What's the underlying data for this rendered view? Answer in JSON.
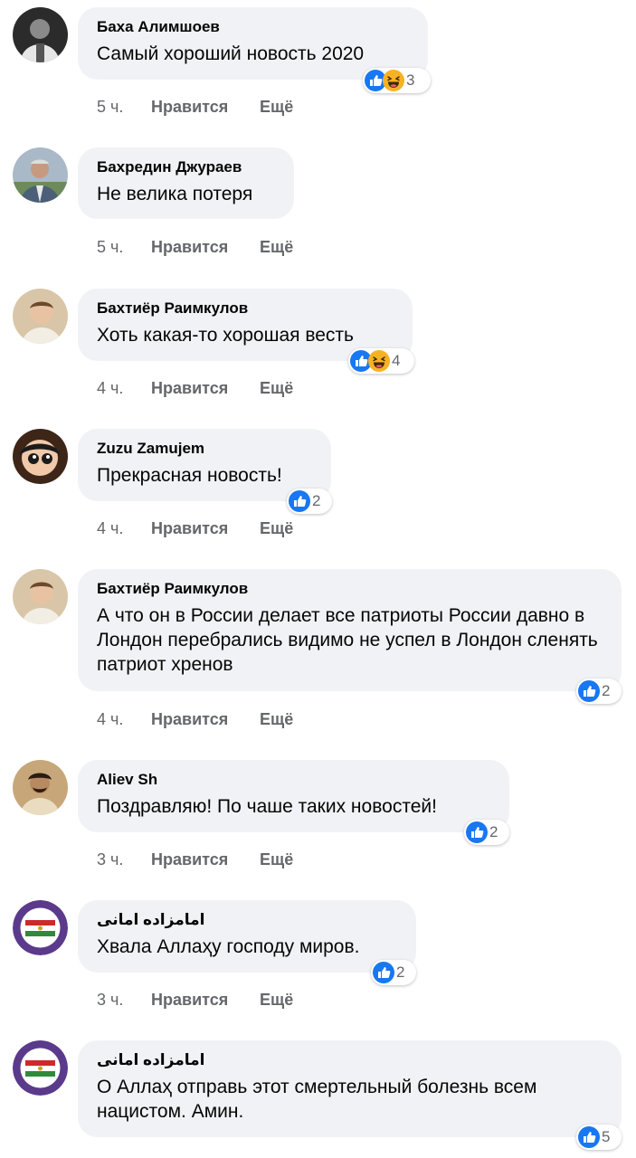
{
  "colors": {
    "bubble": "#f0f2f5",
    "meta": "#65676b",
    "like_blue": "#1877f2",
    "haha_yellow": "#f7b125"
  },
  "comments": [
    {
      "author": "Баха Алимшоев",
      "text": "Самый хороший новость 2020",
      "reactions": [
        "like-icon",
        "haha-icon"
      ],
      "count": "3",
      "time": "5 ч.",
      "like": "Нравится",
      "more": "Ещё"
    },
    {
      "author": "Бахредин Джураев",
      "text": "Не велика потеря",
      "reactions": [],
      "count": "",
      "time": "5 ч.",
      "like": "Нравится",
      "more": "Ещё"
    },
    {
      "author": "Бахтиёр Раимкулов",
      "text": "Хоть какая-то хорошая весть",
      "reactions": [
        "like-icon",
        "haha-icon"
      ],
      "count": "4",
      "time": "4 ч.",
      "like": "Нравится",
      "more": "Ещё"
    },
    {
      "author": "Zuzu Zamujem",
      "text": "Прекрасная новость!",
      "reactions": [
        "like-icon"
      ],
      "count": "2",
      "time": "4 ч.",
      "like": "Нравится",
      "more": "Ещё"
    },
    {
      "author": "Бахтиёр Раимкулов",
      "text": "А что он в России делает все патриоты России давно в Лондон перебрались видимо не успел в Лондон сленять патриот хренов",
      "reactions": [
        "like-icon"
      ],
      "count": "2",
      "time": "4 ч.",
      "like": "Нравится",
      "more": "Ещё"
    },
    {
      "author": "Aliev Sh",
      "text": "Поздравляю! По чаше таких новостей!",
      "reactions": [
        "like-icon"
      ],
      "count": "2",
      "time": "3 ч.",
      "like": "Нравится",
      "more": "Ещё"
    },
    {
      "author": "امامزاده امانی",
      "text": "Хвала Аллаҳу господу миров.",
      "reactions": [
        "like-icon"
      ],
      "count": "2",
      "time": "3 ч.",
      "like": "Нравится",
      "more": "Ещё"
    },
    {
      "author": "امامزاده امانی",
      "text": "О Аллаҳ отправь этот смертельный болезнь всем нацистом. Амин.",
      "reactions": [
        "like-icon"
      ],
      "count": "5",
      "time": "",
      "like": "",
      "more": ""
    }
  ]
}
